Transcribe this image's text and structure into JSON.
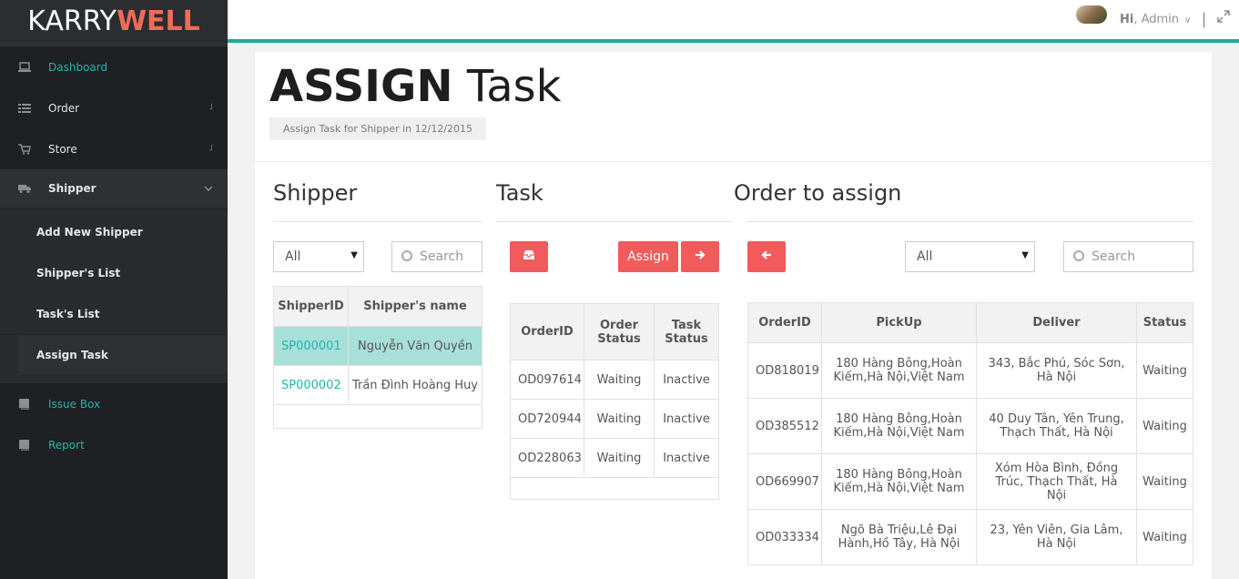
{
  "brand": {
    "part1": "KARRY",
    "part2": "WELL"
  },
  "sidebar": {
    "items": [
      {
        "label": "Dashboard",
        "icon": "laptop-icon"
      },
      {
        "label": "Order",
        "icon": "list-icon"
      },
      {
        "label": "Store",
        "icon": "cart-icon"
      },
      {
        "label": "Shipper",
        "icon": "truck-icon"
      }
    ],
    "shipper_sub": [
      "Add New Shipper",
      "Shipper's List",
      "Task's List",
      "Assign Task"
    ],
    "lower": [
      {
        "label": "Issue Box",
        "icon": "book-icon"
      },
      {
        "label": "Report",
        "icon": "book-icon"
      }
    ]
  },
  "header": {
    "hi": "Hi",
    "user": ", Admin"
  },
  "page": {
    "title_bold": "ASSIGN",
    "title_light": "Task",
    "subtitle": "Assign Task for Shipper in 12/12/2015"
  },
  "shipper": {
    "heading": "Shipper",
    "filter": "All",
    "search_placeholder": "Search",
    "columns": [
      "ShipperID",
      "Shipper's name"
    ],
    "rows": [
      {
        "id": "SP000001",
        "name": "Nguyễn Văn Quyền"
      },
      {
        "id": "SP000002",
        "name": "Trần Đình Hoàng Huy"
      }
    ]
  },
  "task": {
    "heading": "Task",
    "assign_label": "Assign",
    "columns": [
      "OrderID",
      "Order Status",
      "Task Status"
    ],
    "rows": [
      {
        "id": "OD097614",
        "order_status": "Waiting",
        "task_status": "Inactive"
      },
      {
        "id": "OD720944",
        "order_status": "Waiting",
        "task_status": "Inactive"
      },
      {
        "id": "OD228063",
        "order_status": "Waiting",
        "task_status": "Inactive"
      }
    ]
  },
  "orders": {
    "heading": "Order to assign",
    "filter": "All",
    "search_placeholder": "Search",
    "columns": [
      "OrderID",
      "PickUp",
      "Deliver",
      "Status"
    ],
    "rows": [
      {
        "id": "OD818019",
        "pickup": "180 Hàng Bông,Hoàn Kiếm,Hà Nội,Việt Nam",
        "deliver": "343, Bắc Phú, Sóc Sơn, Hà Nội",
        "status": "Waiting"
      },
      {
        "id": "OD385512",
        "pickup": "180 Hàng Bông,Hoàn Kiếm,Hà Nội,Việt Nam",
        "deliver": "40 Duy Tân, Yên Trung, Thạch Thất, Hà Nội",
        "status": "Waiting"
      },
      {
        "id": "OD669907",
        "pickup": "180 Hàng Bông,Hoàn Kiếm,Hà Nội,Việt Nam",
        "deliver": "Xóm Hòa Bình, Đồng Trúc, Thạch Thất, Hà Nội",
        "status": "Waiting"
      },
      {
        "id": "OD033334",
        "pickup": "Ngõ Bà Triệu,Lê Đại Hành,Hồ Tây, Hà Nội",
        "deliver": "23, Yên Viên, Gia Lâm, Hà Nội",
        "status": "Waiting"
      }
    ]
  },
  "colors": {
    "accent": "#1fb5ad",
    "button": "#f15b5b",
    "sidebar": "#1f2023"
  }
}
